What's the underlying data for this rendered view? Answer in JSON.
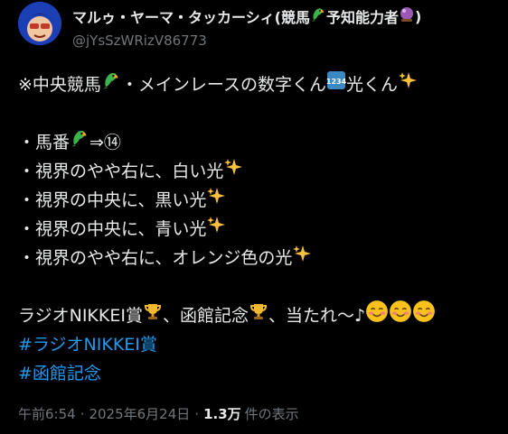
{
  "author": {
    "display_name": "マルゥ・ヤーマ・タッカーシィ(競馬",
    "display_name_mid": " 予知能力者",
    "display_name_end": ")",
    "handle": "@jYsSzWRizV86773"
  },
  "post": {
    "line1_a": "※中央競馬",
    "line1_b": "・メインレースの数字くん",
    "line1_c": "光くん",
    "line2_a": "・馬番",
    "line2_b": "⇒⑭",
    "line3": "・視界のやや右に、白い光",
    "line4": "・視界の中央に、黒い光",
    "line5": "・視界の中央に、青い光",
    "line6": "・視界のやや右に、オレンジ色の光",
    "line7_a": "ラジオNIKKEI賞",
    "line7_b": "、函館記念",
    "line7_c": "、当たれ～♪",
    "hashtag1": "#ラジオNIKKEI賞",
    "hashtag2": "#函館記念",
    "number_block": "1234"
  },
  "meta": {
    "time": "午前6:54",
    "separator": "·",
    "date": "2025年6月24日",
    "views_count": "1.3万",
    "views_label": "件の表示"
  },
  "icons": {
    "parrot": "parrot-icon",
    "crystal_ball": "crystal-ball-icon",
    "sparkles": "sparkles-icon",
    "trophy": "trophy-icon",
    "smiling_face": "smiling-face-icon",
    "number_keycap": "input-numbers-icon"
  },
  "colors": {
    "background": "#000000",
    "text": "#e7e9ea",
    "secondary": "#71767b",
    "link": "#1d9bf0"
  }
}
